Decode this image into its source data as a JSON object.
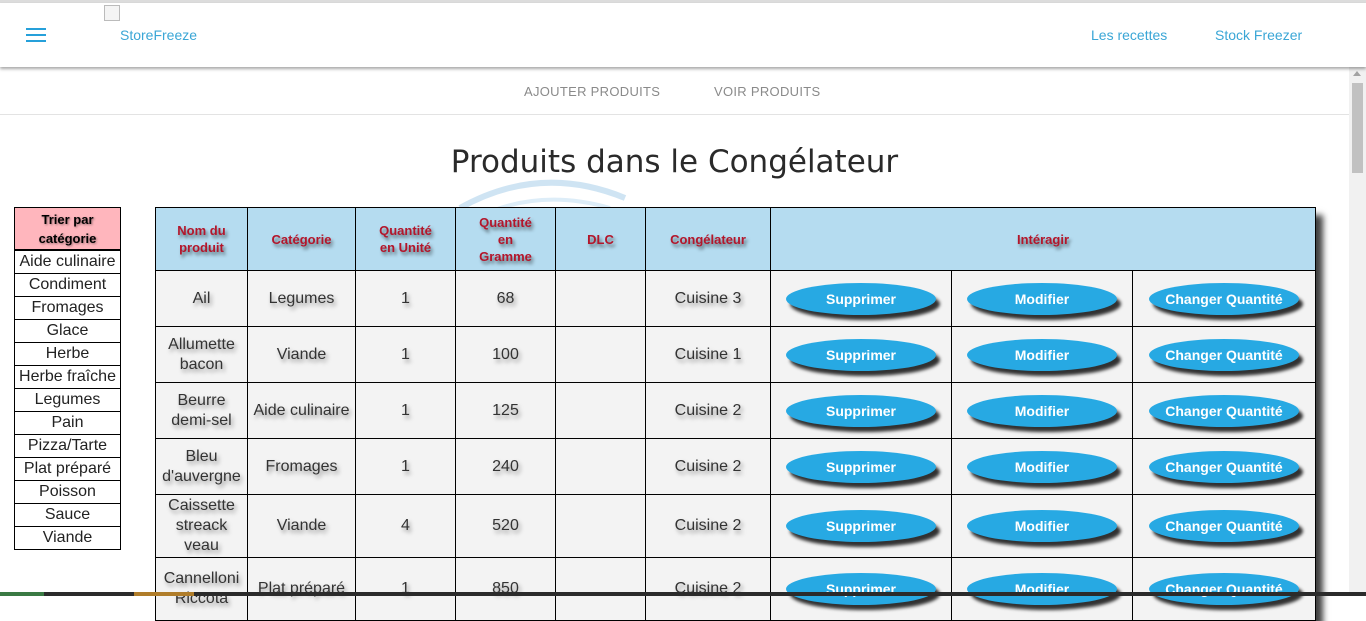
{
  "navbar": {
    "menu_icon": "hamburger-menu-icon",
    "logo_alt": "StoreFreeze",
    "links": [
      "Les recettes",
      "Stock Freezer"
    ]
  },
  "subnav": {
    "tabs": [
      "AJOUTER PRODUITS",
      "VOIR PRODUITS"
    ]
  },
  "page_title": "Produits dans le Congélateur",
  "sidebar": {
    "header": "Trier par catégorie",
    "items": [
      "Aide culinaire",
      "Condiment",
      "Fromages",
      "Glace",
      "Herbe",
      "Herbe fraîche",
      "Legumes",
      "Pain",
      "Pizza/Tarte",
      "Plat préparé",
      "Poisson",
      "Sauce",
      "Viande"
    ]
  },
  "table": {
    "headers": [
      "Nom du produit",
      "Catégorie",
      "Quantité en Unité",
      "Quantité en Gramme",
      "DLC",
      "Congélateur",
      "Intéragir"
    ],
    "actions": [
      "Supprimer",
      "Modifier",
      "Changer Quantité"
    ],
    "rows": [
      {
        "nom": "Ail",
        "categorie": "Legumes",
        "unite": "1",
        "gramme": "68",
        "dlc": "",
        "congelateur": "Cuisine 3"
      },
      {
        "nom": "Allumette bacon",
        "categorie": "Viande",
        "unite": "1",
        "gramme": "100",
        "dlc": "",
        "congelateur": "Cuisine 1"
      },
      {
        "nom": "Beurre demi-sel",
        "categorie": "Aide culinaire",
        "unite": "1",
        "gramme": "125",
        "dlc": "",
        "congelateur": "Cuisine 2"
      },
      {
        "nom": "Bleu d'auvergne",
        "categorie": "Fromages",
        "unite": "1",
        "gramme": "240",
        "dlc": "",
        "congelateur": "Cuisine 2"
      },
      {
        "nom": "Caissette streack veau",
        "categorie": "Viande",
        "unite": "4",
        "gramme": "520",
        "dlc": "",
        "congelateur": "Cuisine 2"
      },
      {
        "nom": "Cannelloni Riccota",
        "categorie": "Plat préparé",
        "unite": "1",
        "gramme": "850",
        "dlc": "",
        "congelateur": "Cuisine 2"
      }
    ]
  },
  "colors": {
    "accent": "#27a9e3",
    "header_bg": "#b5dcf0",
    "header_text": "#b3162b",
    "sidebar_head": "#ffb6bd"
  }
}
